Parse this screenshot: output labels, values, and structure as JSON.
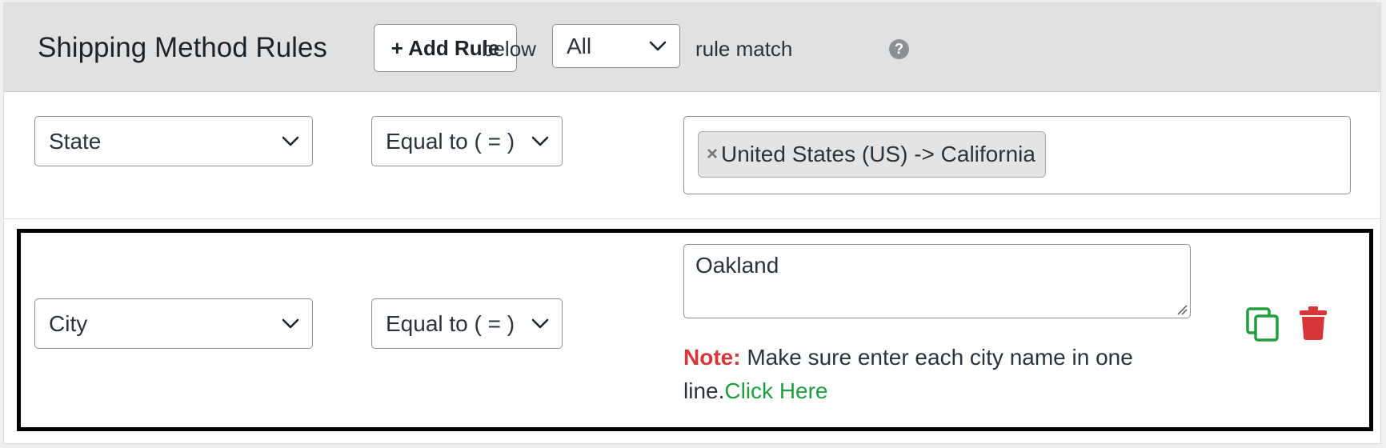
{
  "header": {
    "title": "Shipping Method Rules",
    "add_rule_label": "+ Add Rule",
    "below_text": "below",
    "match_select_value": "All",
    "rule_match_text": "rule match",
    "help_glyph": "?"
  },
  "rules": [
    {
      "field": "State",
      "operator": "Equal to ( = )",
      "chips": [
        {
          "remove_glyph": "×",
          "label": "United States (US) -> California"
        }
      ]
    },
    {
      "field": "City",
      "operator": "Equal to ( = )",
      "textarea_value": "Oakland",
      "note_label": "Note:",
      "note_text": " Make sure enter each city name in one line.",
      "note_link": "Click Here"
    }
  ],
  "icons": {
    "duplicate": "copy-icon",
    "delete": "trash-icon",
    "help": "question-circle-icon",
    "chevron": "chevron-down-icon"
  },
  "colors": {
    "header_bg": "#e1e1e1",
    "note_red": "#d63638",
    "link_green": "#1e9e3e",
    "duplicate_green": "#1e9e3e",
    "delete_red": "#d63638",
    "highlight_border": "#000000"
  }
}
